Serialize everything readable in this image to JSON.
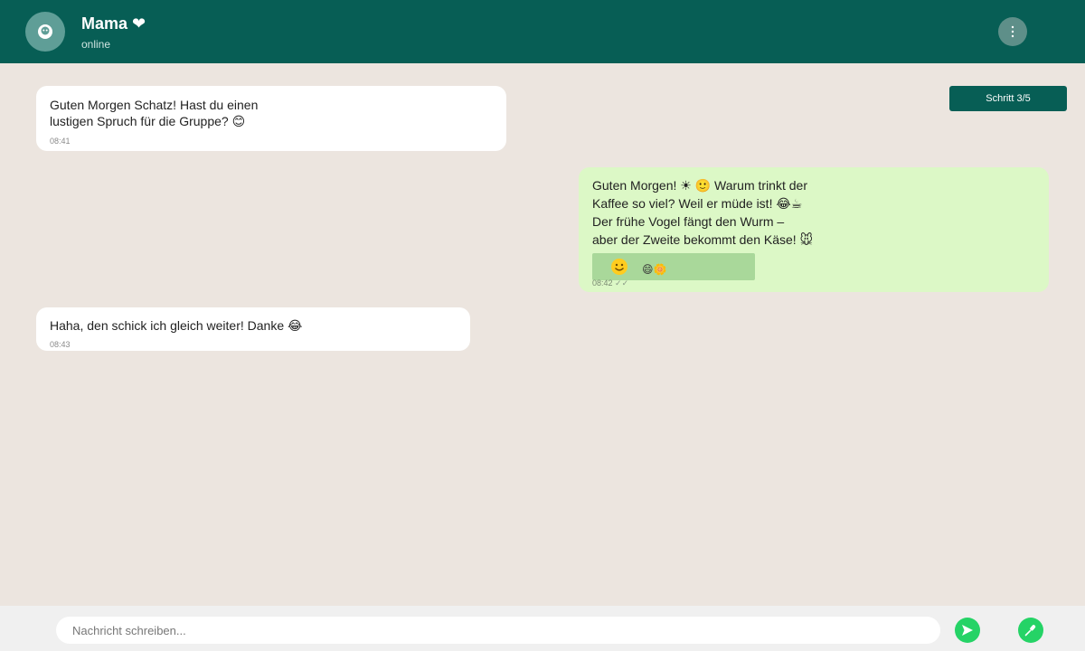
{
  "header": {
    "contact_name": "Mama ❤",
    "status": "online"
  },
  "step_badge": "Schritt 3/5",
  "messages": [
    {
      "direction": "incoming",
      "lines": [
        "Guten Morgen Schatz! Hast du einen",
        "lustigen Spruch für die Gruppe? 😊"
      ],
      "time": "08:41"
    },
    {
      "direction": "outgoing",
      "lines": [
        "Guten Morgen! ☀ 🙂 Warum trinkt der",
        "Kaffee so viel? Weil er müde ist! 😂☕",
        "Der frühe Vogel fängt den Wurm –",
        "aber der Zweite bekommt den Käse!  🐭"
      ],
      "emoji_strip": "🙂",
      "emoji_strip_extra": "😄🌼",
      "time": "08:42",
      "ticks": "✓✓"
    },
    {
      "direction": "incoming",
      "lines": [
        "Haha, den schick ich gleich weiter! Danke 😂"
      ],
      "time": "08:43"
    }
  ],
  "composer": {
    "placeholder": "Nachricht schreiben..."
  },
  "icons": {
    "avatar": "person-avatar-icon",
    "menu": "more-vertical-icon",
    "send": "send-icon",
    "mic": "microphone-icon"
  },
  "colors": {
    "header": "#075e55",
    "background": "#ece5df",
    "incoming_bubble": "#ffffff",
    "outgoing_bubble": "#dcf8c6",
    "accent": "#25d366"
  }
}
